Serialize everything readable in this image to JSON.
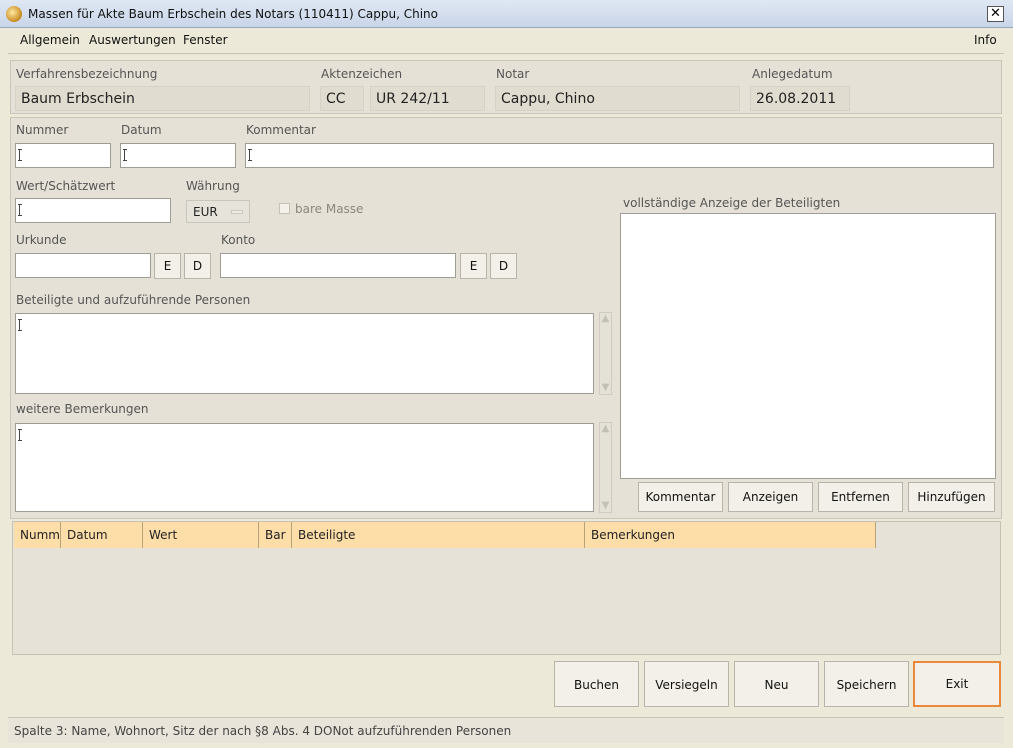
{
  "window": {
    "title": "Massen für Akte Baum Erbschein des Notars (110411) Cappu, Chino",
    "close_symbol": "✕"
  },
  "menu": {
    "items": [
      "Allgemein",
      "Auswertungen",
      "Fenster"
    ],
    "info": "Info"
  },
  "header": {
    "verfahren_label": "Verfahrensbezeichnung",
    "verfahren_value": "Baum Erbschein",
    "akten_label": "Aktenzeichen",
    "akten_court": "CC",
    "akten_number": "UR 242/11",
    "notar_label": "Notar",
    "notar_value": "Cappu, Chino",
    "anlege_label": "Anlegedatum",
    "anlege_value": "26.08.2011"
  },
  "form": {
    "nummer_label": "Nummer",
    "datum_label": "Datum",
    "kommentar_label": "Kommentar",
    "wert_label": "Wert/Schätzwert",
    "waehrung_label": "Währung",
    "waehrung_value": "EUR",
    "bare_masse_label": "bare Masse",
    "urkunde_label": "Urkunde",
    "konto_label": "Konto",
    "e_label": "E",
    "d_label": "D",
    "beteiligte_label": "Beteiligte und aufzuführende Personen",
    "bemerkungen_label": "weitere Bemerkungen"
  },
  "right_panel": {
    "label": "vollständige Anzeige der Beteiligten",
    "buttons": [
      "Kommentar",
      "Anzeigen",
      "Entfernen",
      "Hinzufügen"
    ]
  },
  "table": {
    "columns": [
      "Numm",
      "Datum",
      "Wert",
      "Bar",
      "Beteiligte",
      "Bemerkungen"
    ],
    "rows": []
  },
  "actions": {
    "buttons": [
      "Buchen",
      "Versiegeln",
      "Neu",
      "Speichern",
      "Exit"
    ]
  },
  "status": {
    "text": "Spalte 3: Name, Wohnort, Sitz der nach §8 Abs. 4 DONot aufzuführenden Personen"
  },
  "colors": {
    "table_header": "#fddea8",
    "focus_border": "#e8893c",
    "window_bg": "#ece9d8"
  }
}
